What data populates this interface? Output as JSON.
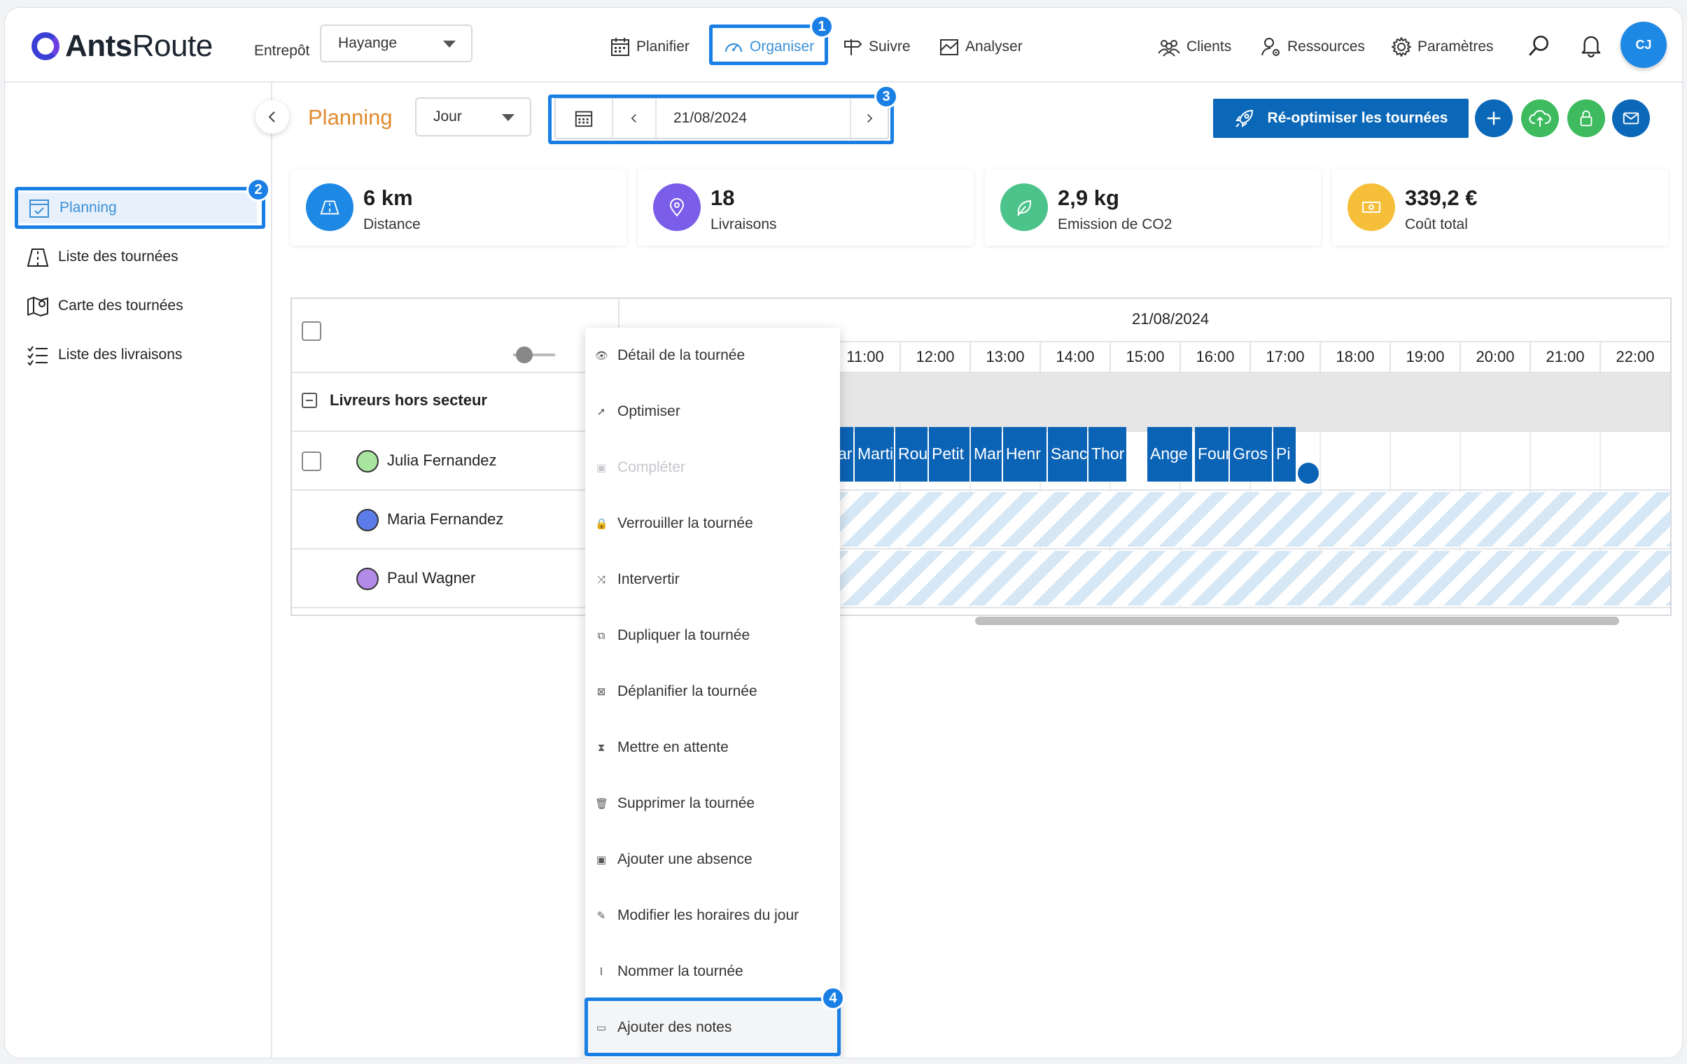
{
  "header": {
    "logo_bold": "Ants",
    "logo_light": "Route",
    "warehouse_label": "Entrepôt",
    "warehouse_value": "Hayange",
    "nav": [
      "Planifier",
      "Organiser",
      "Suivre",
      "Analyser"
    ],
    "nav_right": [
      "Clients",
      "Ressources",
      "Paramètres"
    ],
    "avatar_initials": "CJ"
  },
  "badges": [
    "1",
    "2",
    "3",
    "4"
  ],
  "sidebar": {
    "items": [
      "Planning",
      "Liste des tournées",
      "Carte des tournées",
      "Liste des livraisons"
    ]
  },
  "toolbar": {
    "title": "Planning",
    "view_mode": "Jour",
    "date": "21/08/2024",
    "reoptimize_label": "Ré-optimiser les tournées"
  },
  "stats": [
    {
      "value": "6 km",
      "label": "Distance"
    },
    {
      "value": "18",
      "label": "Livraisons"
    },
    {
      "value": "2,9 kg",
      "label": "Emission de CO2"
    },
    {
      "value": "339,2 €",
      "label": "Coût total"
    }
  ],
  "gantt": {
    "date_header": "21/08/2024",
    "hours": [
      "11:00",
      "12:00",
      "13:00",
      "14:00",
      "15:00",
      "16:00",
      "17:00",
      "18:00",
      "19:00",
      "20:00",
      "21:00",
      "22:00"
    ],
    "group_label": "Livreurs hors secteur",
    "drivers": [
      {
        "name": "Julia Fernandez",
        "color": "#a8e6a0"
      },
      {
        "name": "Maria Fernandez",
        "color": "#5b7be8"
      },
      {
        "name": "Paul Wagner",
        "color": "#b48ae8"
      }
    ],
    "tasks": [
      "ar",
      "Marti",
      "Rou",
      "Petit",
      "Mar",
      "Henr",
      "Sanc",
      "Thor",
      "Ange",
      "Four",
      "Gros",
      "Pi"
    ]
  },
  "context_menu": {
    "items": [
      {
        "label": "Détail de la tournée",
        "icon": "eye-icon",
        "disabled": false
      },
      {
        "label": "Optimiser",
        "icon": "rocket-icon",
        "disabled": false
      },
      {
        "label": "Compléter",
        "icon": "calendar-icon",
        "disabled": true
      },
      {
        "label": "Verrouiller la tournée",
        "icon": "lock-icon",
        "disabled": false
      },
      {
        "label": "Intervertir",
        "icon": "shuffle-icon",
        "disabled": false
      },
      {
        "label": "Dupliquer la tournée",
        "icon": "copy-icon",
        "disabled": false
      },
      {
        "label": "Déplanifier la tournée",
        "icon": "calendar-x-icon",
        "disabled": false
      },
      {
        "label": "Mettre en attente",
        "icon": "hourglass-icon",
        "disabled": false
      },
      {
        "label": "Supprimer la tournée",
        "icon": "trash-icon",
        "disabled": false
      },
      {
        "label": "Ajouter une absence",
        "icon": "calendar-icon",
        "disabled": false
      },
      {
        "label": "Modifier les horaires du jour",
        "icon": "pencil-icon",
        "disabled": false
      },
      {
        "label": "Nommer la tournée",
        "icon": "text-cursor-icon",
        "disabled": false
      },
      {
        "label": "Ajouter des notes",
        "icon": "note-icon",
        "disabled": false
      }
    ]
  },
  "colors": {
    "accent": "#1a7fe5",
    "task": "#0b63b5",
    "title": "#e08a2e",
    "stat_distance": "#1e88e5",
    "stat_deliveries": "#7a5de8",
    "stat_co2": "#4cc38a",
    "stat_cost": "#f6bf3a"
  }
}
